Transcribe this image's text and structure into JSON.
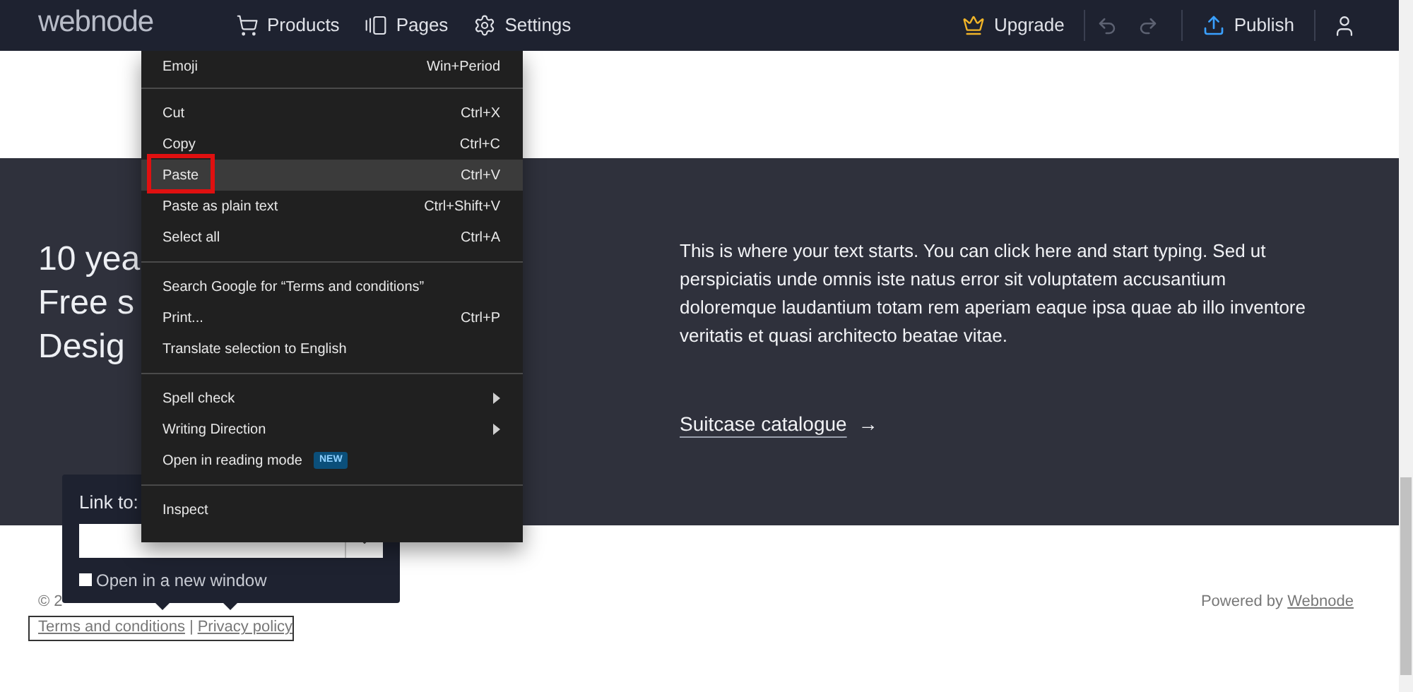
{
  "topbar": {
    "logo": "webnode",
    "nav": [
      {
        "label": "Products"
      },
      {
        "label": "Pages"
      },
      {
        "label": "Settings"
      }
    ],
    "upgrade": "Upgrade",
    "undo_disabled": true,
    "redo_disabled": true,
    "publish": "Publish"
  },
  "hero": {
    "headline_lines": [
      "10 yea",
      "Free s",
      "Desig"
    ],
    "body": "This is where your text starts. You can click here and start typing. Sed ut perspiciatis unde omnis iste natus error sit voluptatem accusantium doloremque laudantium totam rem aperiam eaque ipsa quae ab illo inventore veritatis et quasi architecto beatae vitae.",
    "link": "Suitcase catalogue",
    "link_arrow": "→"
  },
  "footer": {
    "copyright": "© 2",
    "links": [
      "Terms and conditions",
      "Privacy policy"
    ],
    "separator": "|",
    "powered_by": "Powered by",
    "powered_link": "Webnode"
  },
  "link_popup": {
    "label": "Link to:",
    "new_window": {
      "label": "Open in a new window",
      "checked": false
    }
  },
  "context_menu": {
    "groups": [
      [
        {
          "kind": "item",
          "label": "Emoji",
          "shortcut": "Win+Period",
          "highlighted": false
        }
      ],
      [
        {
          "kind": "item",
          "label": "Cut",
          "shortcut": "Ctrl+X",
          "highlighted": false
        },
        {
          "kind": "item",
          "label": "Copy",
          "shortcut": "Ctrl+C",
          "highlighted": false
        },
        {
          "kind": "item",
          "label": "Paste",
          "shortcut": "Ctrl+V",
          "highlighted": true
        },
        {
          "kind": "item",
          "label": "Paste as plain text",
          "shortcut": "Ctrl+Shift+V",
          "highlighted": false
        },
        {
          "kind": "item",
          "label": "Select all",
          "shortcut": "Ctrl+A",
          "highlighted": false
        }
      ],
      [
        {
          "kind": "item",
          "label": "Search Google for “Terms and conditions”",
          "highlighted": false
        },
        {
          "kind": "item",
          "label": "Print...",
          "shortcut": "Ctrl+P",
          "highlighted": false
        },
        {
          "kind": "item",
          "label": "Translate selection to English",
          "highlighted": false
        }
      ],
      [
        {
          "kind": "submenu",
          "label": "Spell check",
          "highlighted": false
        },
        {
          "kind": "submenu",
          "label": "Writing Direction",
          "highlighted": false
        },
        {
          "kind": "badge",
          "label": "Open in reading mode",
          "badge": "NEW",
          "highlighted": false
        }
      ],
      [
        {
          "kind": "item",
          "label": "Inspect",
          "highlighted": false
        }
      ]
    ]
  }
}
